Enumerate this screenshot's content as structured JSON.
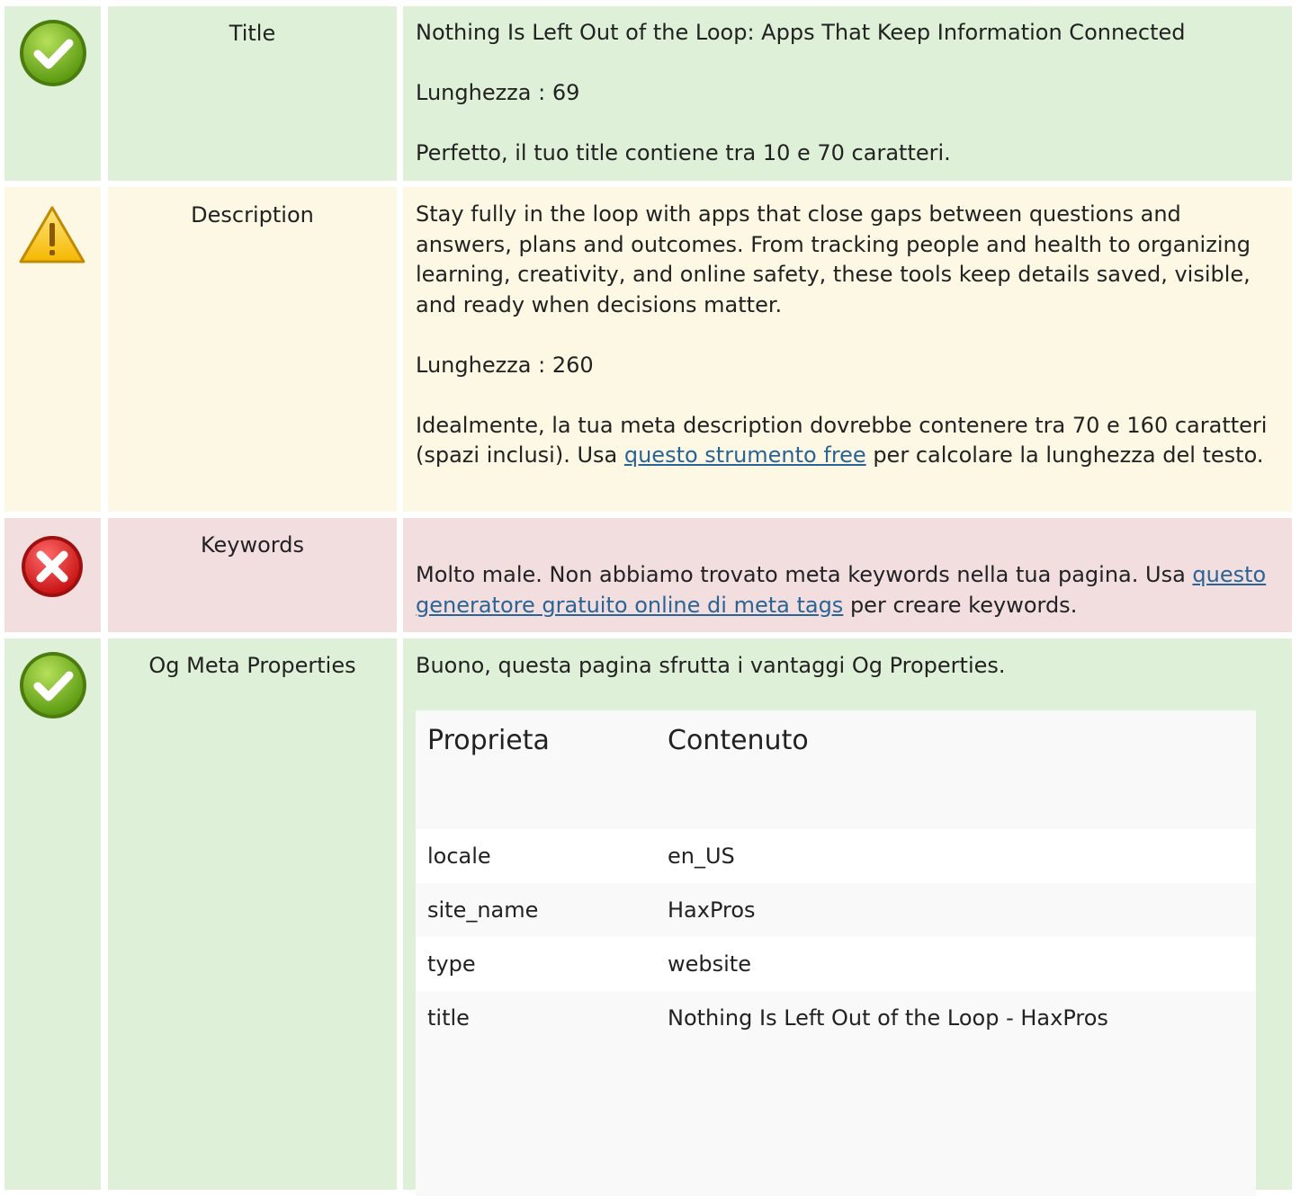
{
  "rows": {
    "title": {
      "status": "good",
      "label": "Title",
      "value": "Nothing Is Left Out of the Loop: Apps That Keep Information Connected",
      "length": "Lunghezza : 69",
      "message": "Perfetto, il tuo title contiene tra 10 e 70 caratteri."
    },
    "description": {
      "status": "warning",
      "label": "Description",
      "value": "Stay fully in the loop with apps that close gaps between questions and answers, plans and outcomes. From tracking people and health to organizing learning, creativity, and online safety, these tools keep details saved, visible, and ready when decisions matter.",
      "length": "Lunghezza : 260",
      "message_before": "Idealmente, la tua meta description dovrebbe contenere tra 70 e 160 caratteri (spazi inclusi). Usa ",
      "link": "questo strumento free",
      "message_after": " per calcolare la lunghezza del testo."
    },
    "keywords": {
      "status": "error",
      "label": "Keywords",
      "message_before": "Molto male. Non abbiamo trovato meta keywords nella tua pagina. Usa ",
      "link": "questo generatore gratuito online di meta tags",
      "message_after": " per creare keywords."
    },
    "og": {
      "status": "good",
      "label": "Og Meta Properties",
      "message": "Buono, questa pagina sfrutta i vantaggi Og Properties.",
      "table": {
        "headers": [
          "Proprieta",
          "Contenuto"
        ],
        "rows": [
          [
            "locale",
            "en_US"
          ],
          [
            "site_name",
            "HaxPros"
          ],
          [
            "type",
            "website"
          ],
          [
            "title",
            "Nothing Is Left Out of the Loop - HaxPros"
          ]
        ]
      }
    }
  },
  "colors": {
    "good_bg": "#dff0d8",
    "warning_bg": "#fcf8e3",
    "error_bg": "#f2dede",
    "link": "#2a6496"
  },
  "icons": {
    "good": "check-circle-icon",
    "warning": "warning-triangle-icon",
    "error": "error-x-icon"
  }
}
